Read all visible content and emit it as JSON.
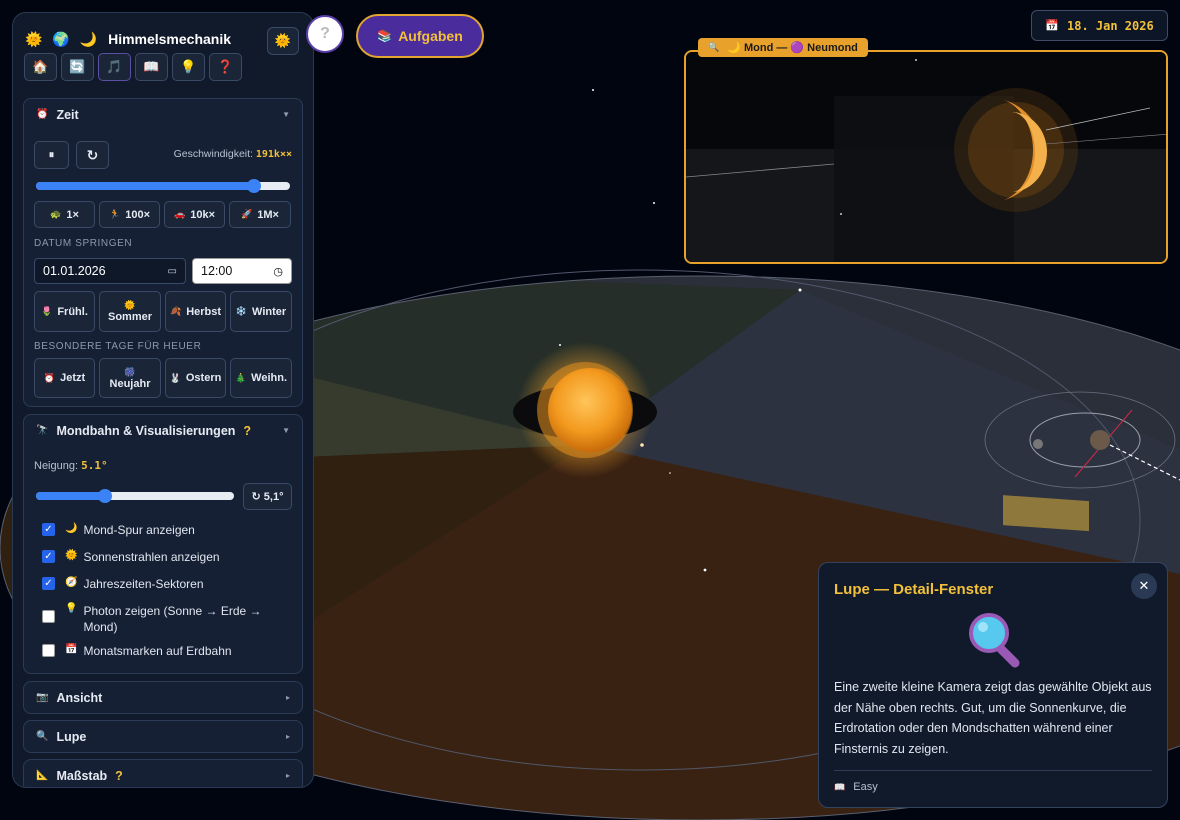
{
  "header": {
    "title": "Himmelsmechanik",
    "title_icons": "🌞 🌍 🌙",
    "sun_button_icon": "🌞",
    "icons": [
      "🏠",
      "🔄",
      "🎵",
      "📖",
      "💡",
      "❓"
    ]
  },
  "help_button": {
    "label": "?"
  },
  "aufgaben_button": {
    "icon": "📚",
    "label": "Aufgaben"
  },
  "date_badge": {
    "icon": "📅",
    "label": "18. Jan 2026"
  },
  "zeit": {
    "title": "Zeit",
    "icon": "⏰",
    "pause_label": "⏸",
    "reset_label": "↻",
    "speed_label": "Geschwindigkeit:",
    "speed_value": "191k××",
    "speed_slider_fraction": 0.86,
    "speed_buttons": [
      {
        "icon": "🐢",
        "label": "1×"
      },
      {
        "icon": "🏃",
        "label": "100×"
      },
      {
        "icon": "🚗",
        "label": "10k×"
      },
      {
        "icon": "🚀",
        "label": "1M×"
      }
    ],
    "jump_label": "Datum springen",
    "date_value": "01.01.2026",
    "time_value": "12:00",
    "seasons": [
      {
        "icon": "🌷",
        "label": "Frühl."
      },
      {
        "icon": "🌞",
        "label": "Sommer"
      },
      {
        "icon": "🍂",
        "label": "Herbst"
      },
      {
        "icon": "❄️",
        "label": "Winter"
      }
    ],
    "special_label": "Besondere Tage für heuer",
    "special_days": [
      {
        "icon": "⏰",
        "label": "Jetzt"
      },
      {
        "icon": "🎆",
        "label": "Neujahr"
      },
      {
        "icon": "🐰",
        "label": "Ostern"
      },
      {
        "icon": "🎄",
        "label": "Weihn."
      }
    ]
  },
  "mondbahn": {
    "title": "Mondbahn & Visualisierungen",
    "icon": "🔭",
    "help": "?",
    "neigung_label": "Neigung:",
    "neigung_value": "5.1°",
    "neigung_fraction": 0.35,
    "reset_label": "↻ 5,1°",
    "checks": [
      {
        "checked": true,
        "icon": "🌙",
        "label": "Mond-Spur anzeigen"
      },
      {
        "checked": true,
        "icon": "🌞",
        "label": "Sonnenstrahlen anzeigen"
      },
      {
        "checked": true,
        "icon": "🧭",
        "label": "Jahreszeiten-Sektoren"
      },
      {
        "checked": false,
        "icon": "💡",
        "label": "Photon zeigen (Sonne → Erde → Mond)"
      },
      {
        "checked": false,
        "icon": "📅",
        "label": "Monatsmarken auf Erdbahn"
      }
    ]
  },
  "collapsed_sections": [
    {
      "icon": "📷",
      "title": "Ansicht",
      "help": ""
    },
    {
      "icon": "🔍",
      "title": "Lupe",
      "help": ""
    },
    {
      "icon": "📐",
      "title": "Maßstab",
      "help": "?"
    }
  ],
  "lupe_window": {
    "tag_icon": "🔍",
    "tag_label": "🌙 Mond — 🟣 Neumond"
  },
  "info_panel": {
    "title": "Lupe — Detail-Fenster",
    "icon": "🔍",
    "text": "Eine zweite kleine Kamera zeigt das gewählte Objekt aus der Nähe oben rechts. Gut, um die Sonnenkurve, die Erdrotation oder den Mondschatten während einer Finsternis zu zeigen.",
    "footer_icon": "📖",
    "footer_label": "Easy",
    "close": "✕"
  },
  "colors": {
    "accent": "#f3c03b",
    "primary_blue": "#3b82f6",
    "panel_bg": "#101a2b",
    "lupe_border": "#e8a22c",
    "aufgaben_bg": "#4b2c9c"
  }
}
